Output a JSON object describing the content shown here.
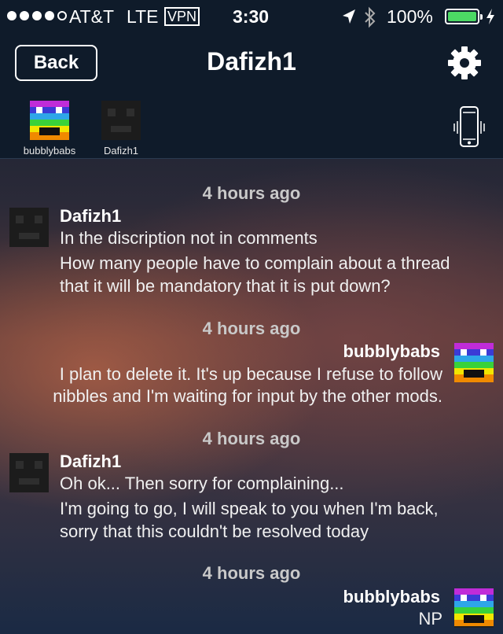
{
  "status_bar": {
    "carrier": "AT&T",
    "network": "LTE",
    "vpn": "VPN",
    "time": "3:30",
    "battery": "100%"
  },
  "nav": {
    "back_label": "Back",
    "title": "Dafizh1"
  },
  "participants": [
    {
      "name": "bubblybabs"
    },
    {
      "name": "Dafizh1"
    }
  ],
  "messages": [
    {
      "timestamp": "4 hours ago",
      "sender": "Dafizh1",
      "side": "left",
      "lines": [
        "In the discription not in comments",
        "How many people have to complain about a thread",
        "that it will be mandatory that it is put down?"
      ]
    },
    {
      "timestamp": "4 hours ago",
      "sender": "bubblybabs",
      "side": "right",
      "lines": [
        "I plan to delete it.  It's up because I refuse to follow",
        "nibbles and I'm waiting for input by the other mods."
      ]
    },
    {
      "timestamp": "4 hours ago",
      "sender": "Dafizh1",
      "side": "left",
      "lines": [
        "Oh ok... Then sorry for complaining...",
        "I'm going to go, I will speak to you when I'm back,",
        "sorry that this couldn't be resolved today"
      ]
    },
    {
      "timestamp": "4 hours ago",
      "sender": "bubblybabs",
      "side": "right",
      "lines": [
        "NP"
      ]
    }
  ],
  "icons": {
    "settings": "gear-icon",
    "vibrate": "phone-vibrate-icon",
    "location": "location-arrow-icon",
    "bluetooth": "bluetooth-icon",
    "charging": "lightning-icon"
  },
  "colors": {
    "battery_fill": "#4cd964",
    "header_bg": "#0f1b2a"
  }
}
